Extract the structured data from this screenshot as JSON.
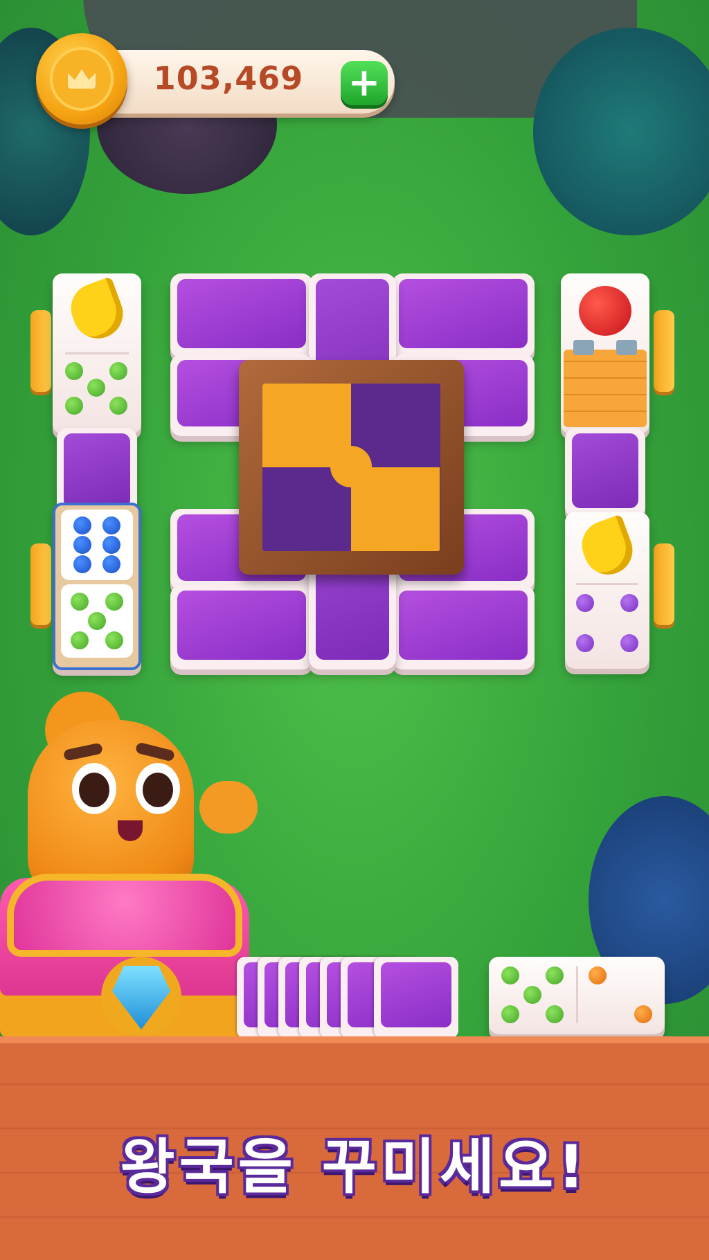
{
  "hud": {
    "coin_count": "103,469",
    "add_symbol": "+"
  },
  "board": {
    "left_column": {
      "top_tile": {
        "icon": "banana",
        "dots": 5,
        "dot_color": "#4caf2a"
      },
      "stacked_dice": [
        {
          "dots": 6,
          "dot_color": "#1f5fd6"
        },
        {
          "dots": 5,
          "dot_color": "#4caf2a"
        }
      ]
    },
    "right_column": {
      "top_tile": {
        "icon": "apple",
        "cover": "wooden-crate"
      },
      "bottom_tile": {
        "icon": "banana",
        "dots": 4,
        "dot_color": "#8a3bd0"
      }
    },
    "center": {
      "frame": "puzzle-frame",
      "puzzle_colors": [
        "#f5a623",
        "#5a2a8c"
      ]
    }
  },
  "hand": {
    "draw_pile": "face-down-card-stack",
    "current_domino": {
      "left_dots": 5,
      "left_color": "#4caf2a",
      "right_dots": 2,
      "right_color": "#f07a12"
    }
  },
  "banner": {
    "slogan": "왕국을 꾸미세요!"
  },
  "colors": {
    "background": "#3aa83c",
    "tile_purple": "#9a3dd0",
    "floor_wood": "#d86a3c",
    "slogan_outline": "#5b2a9a"
  }
}
